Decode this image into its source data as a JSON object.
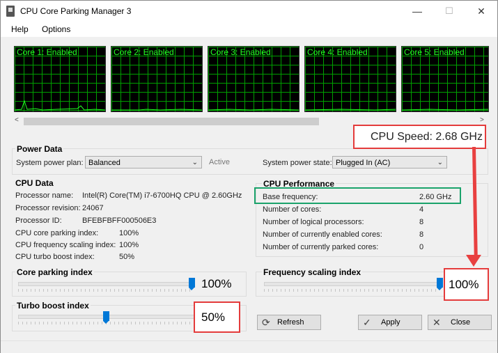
{
  "window": {
    "title": "CPU Core Parking Manager 3",
    "minimize": "—",
    "maximize": "☐",
    "close": "✕"
  },
  "menu": {
    "items": [
      {
        "label": "Help"
      },
      {
        "label": "Options"
      }
    ]
  },
  "cores": [
    {
      "label": "Core 1: Enabled"
    },
    {
      "label": "Core 2: Enabled"
    },
    {
      "label": "Core 3: Enabled"
    },
    {
      "label": "Core 4: Enabled"
    },
    {
      "label": "Core 5: Enabled"
    }
  ],
  "scroll": {
    "left_arrow": "<",
    "right_arrow": ">"
  },
  "cpu_speed": "CPU Speed: 2.68 GHz",
  "power_data": {
    "title": "Power Data",
    "plan_label": "System power plan:",
    "plan_value": "Balanced",
    "plan_status": "Active",
    "state_label": "System power state:",
    "state_value": "Plugged In (AC)"
  },
  "cpu_data": {
    "title": "CPU Data",
    "rows": [
      {
        "label": "Processor name:",
        "value": "Intel(R) Core(TM) i7-6700HQ CPU @ 2.60GHz"
      },
      {
        "label": "Processor revision:",
        "value": "24067"
      },
      {
        "label": "Processor ID:",
        "value": "BFEBFBFF000506E3"
      },
      {
        "label": "CPU core parking index:",
        "value": "100%"
      },
      {
        "label": "CPU frequency scaling index:",
        "value": "100%"
      },
      {
        "label": "CPU turbo boost index:",
        "value": "50%"
      }
    ]
  },
  "cpu_perf": {
    "title": "CPU Performance",
    "rows": [
      {
        "label": "Base frequency:",
        "value": "2.60 GHz"
      },
      {
        "label": "Number of cores:",
        "value": "4"
      },
      {
        "label": "Number of logical processors:",
        "value": "8"
      },
      {
        "label": "Number of currently enabled cores:",
        "value": "8"
      },
      {
        "label": "Number of currently parked cores:",
        "value": "0"
      }
    ]
  },
  "sliders": {
    "core_parking": {
      "label": "Core parking index",
      "value": "100%",
      "level": 1.0
    },
    "freq_scaling": {
      "label": "Frequency scaling index",
      "value": "100%",
      "level": 1.0
    },
    "turbo_boost": {
      "label": "Turbo boost index",
      "value": "50%",
      "level": 0.5
    }
  },
  "buttons": {
    "refresh": "Refresh",
    "apply": "Apply",
    "close": "Close"
  },
  "colors": {
    "graph_bg": "#000000",
    "grid": "#00a000",
    "graph_text": "#22ff22",
    "accent": "#0078d7",
    "annotation_red": "#e43b3b",
    "annotation_green": "#1aa36b"
  }
}
